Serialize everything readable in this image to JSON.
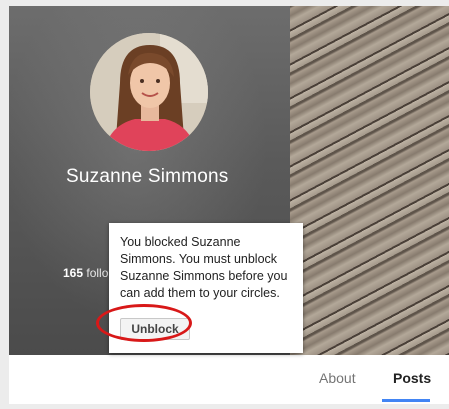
{
  "profile": {
    "name": "Suzanne Simmons",
    "followers_count": "165",
    "followers_suffix": "follo"
  },
  "blocked_popup": {
    "message": "You blocked Suzanne Simmons. You must unblock Suzanne Simmons before you can add them to your circles.",
    "unblock_label": "Unblock"
  },
  "tabs": [
    {
      "label": "About",
      "active": false
    },
    {
      "label": "Posts",
      "active": true
    }
  ],
  "colors": {
    "highlight": "#d81818",
    "active_tab": "#4285f4"
  }
}
